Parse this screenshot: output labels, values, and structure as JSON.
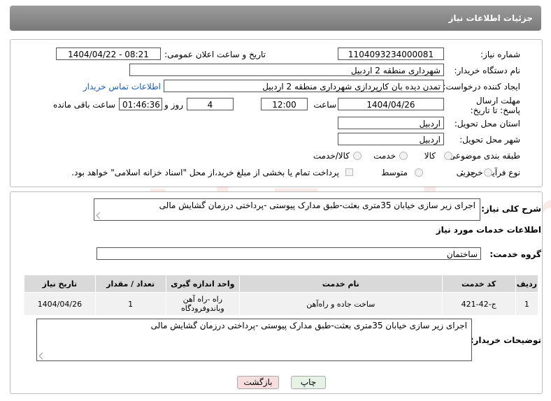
{
  "header": {
    "title": "جزئیات اطلاعات نیاز"
  },
  "form": {
    "need_number": {
      "label": "شماره نیاز:",
      "value": "1104093234000081"
    },
    "announce_date": {
      "label": "تاریخ و ساعت اعلان عمومی:",
      "value": "1404/04/22 - 08:21"
    },
    "buyer_org": {
      "label": "نام دستگاه خریدار:",
      "value": "شهرداری منطقه 2 اردبیل"
    },
    "requester": {
      "label": "ایجاد کننده درخواست:",
      "value": "تمدن دیده بان کارپردازی شهرداری منطقه 2 اردبیل",
      "contact_link": "اطلاعات تماس خریدار"
    },
    "deadline": {
      "label": "مهلت ارسال پاسخ: تا تاریخ:",
      "date": "1404/04/26",
      "time_label": "ساعت",
      "time": "12:00",
      "days": "4",
      "days_label": "روز و",
      "remaining": "01:46:36",
      "remaining_label": "ساعت باقی مانده"
    },
    "province": {
      "label": "استان محل تحویل:",
      "value": "اردبیل"
    },
    "city": {
      "label": "شهر محل تحویل:",
      "value": "اردبیل"
    },
    "category": {
      "label": "طبقه بندی موضوعی:",
      "options": [
        "کالا",
        "خدمت",
        "کالا/خدمت"
      ]
    },
    "process": {
      "label": "نوع فرآیند خرید :",
      "options": [
        "جزیی",
        "متوسط"
      ],
      "note": "پرداخت تمام یا بخشی از مبلغ خرید،از محل \"اسناد خزانه اسلامی\" خواهد بود."
    }
  },
  "summary": {
    "label": "شرح کلی نیاز:",
    "value": "اجرای زیر سازی خیابان 35متری بعثت-طبق مدارک پیوستی -پرداختی درزمان گشایش مالی"
  },
  "services": {
    "section_title": "اطلاعات خدمات مورد نیاز",
    "group_label": "گروه خدمت:",
    "group_value": "ساختمان",
    "columns": [
      "ردیف",
      "کد خدمت",
      "نام خدمت",
      "واحد اندازه گیری",
      "تعداد / مقدار",
      "تاریخ نیاز"
    ],
    "rows": [
      {
        "idx": "1",
        "code": "ج-42-421",
        "name": "ساخت جاده و راه‌آهن",
        "unit": "راه -راه آهن وباندوفرودگاه",
        "qty": "1",
        "date": "1404/04/26"
      }
    ]
  },
  "buyer_notes": {
    "label": "توضیحات خریدار:",
    "value": "اجرای زیر سازی خیابان 35متری بعثت-طبق مدارک پیوستی -پرداختی درزمان گشایش مالی"
  },
  "buttons": {
    "print": "چاپ",
    "back": "بازگشت"
  },
  "watermark": "AriaTender.neT",
  "colors": {
    "header": "#8a8a8a",
    "link": "#1a5fb4",
    "back_button": "#f7dede",
    "print_button": "#e6f2e6"
  }
}
